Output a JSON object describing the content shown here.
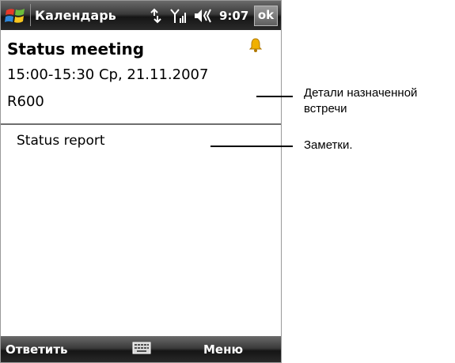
{
  "titlebar": {
    "app_title": "Календарь",
    "clock": "9:07",
    "ok_label": "ok",
    "icons": [
      "windows-start-icon",
      "connectivity-icon",
      "signal-icon",
      "volume-icon"
    ]
  },
  "appointment": {
    "subject": "Status meeting",
    "when": "15:00-15:30 Ср, 21.11.2007",
    "location": "R600",
    "reminder_icon": "bell-icon"
  },
  "notes": {
    "text": "Status report"
  },
  "menubar": {
    "left_softkey": "Ответить",
    "right_softkey": "Меню",
    "center_icon": "keyboard-icon"
  },
  "callouts": {
    "details_line1": "Детали назначенной",
    "details_line2": "встречи",
    "notes": "Заметки."
  },
  "colors": {
    "bar_dark": "#151515",
    "bell": "#f0b000"
  }
}
